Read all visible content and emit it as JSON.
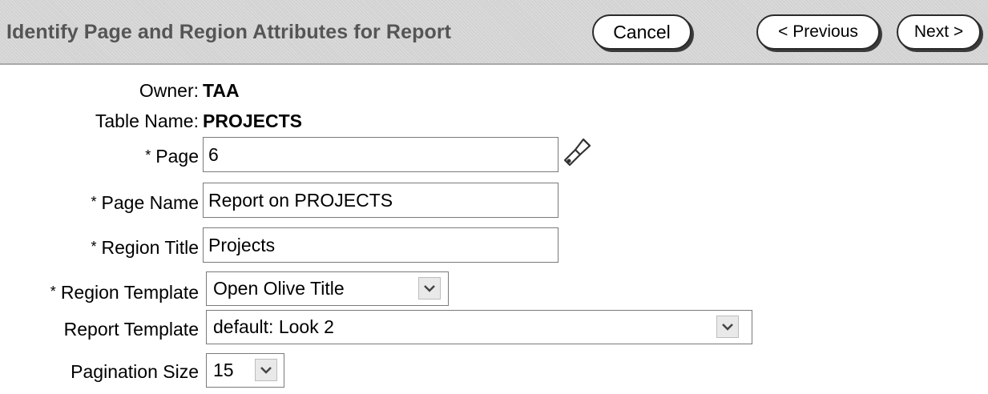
{
  "header": {
    "title": "Identify Page and Region Attributes for Report",
    "cancel_label": "Cancel",
    "previous_label": "< Previous",
    "next_label": "Next >"
  },
  "info": {
    "owner_label": "Owner:",
    "owner_value": "TAA",
    "table_label": "Table Name:",
    "table_value": "PROJECTS"
  },
  "form": {
    "required_marker": "*",
    "page_label": "Page",
    "page_value": "6",
    "page_name_label": "Page Name",
    "page_name_value": "Report on PROJECTS",
    "region_title_label": "Region Title",
    "region_title_value": "Projects",
    "region_template_label": "Region Template",
    "region_template_value": "Open Olive Title",
    "report_template_label": "Report Template",
    "report_template_value": "default: Look 2",
    "pagination_label": "Pagination Size",
    "pagination_value": "15"
  },
  "icons": {
    "lookup": "flashlight-icon",
    "dropdown": "chevron-down-icon"
  }
}
